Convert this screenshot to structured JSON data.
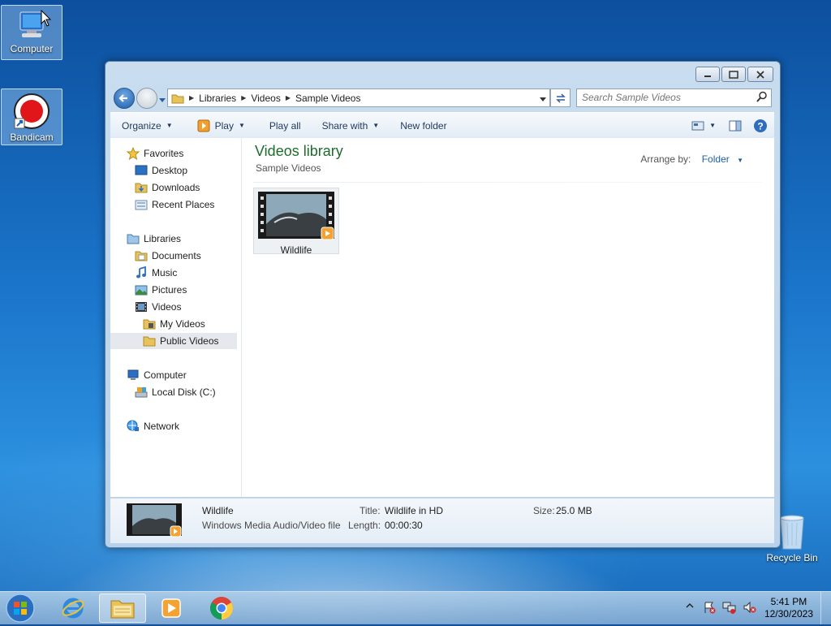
{
  "desktop": {
    "icons": [
      {
        "label": "Computer"
      },
      {
        "label": "Bandicam"
      },
      {
        "label": "Recycle Bin"
      }
    ]
  },
  "window": {
    "breadcrumb": [
      "Libraries",
      "Videos",
      "Sample Videos"
    ],
    "search_placeholder": "Search Sample Videos",
    "toolbar": {
      "organize": "Organize",
      "play": "Play",
      "play_all": "Play all",
      "share_with": "Share with",
      "new_folder": "New folder"
    },
    "nav": {
      "favorites": "Favorites",
      "desktop": "Desktop",
      "downloads": "Downloads",
      "recent_places": "Recent Places",
      "libraries": "Libraries",
      "documents": "Documents",
      "music": "Music",
      "pictures": "Pictures",
      "videos": "Videos",
      "my_videos": "My Videos",
      "public_videos": "Public Videos",
      "computer": "Computer",
      "local_disk": "Local Disk (C:)",
      "network": "Network"
    },
    "library": {
      "title": "Videos library",
      "subtitle": "Sample Videos",
      "arrange_label": "Arrange by:",
      "arrange_value": "Folder"
    },
    "files": [
      {
        "name": "Wildlife"
      }
    ],
    "details": {
      "name": "Wildlife",
      "type": "Windows Media Audio/Video file",
      "title_label": "Title:",
      "title_value": "Wildlife in HD",
      "length_label": "Length:",
      "length_value": "00:00:30",
      "size_label": "Size:",
      "size_value": "25.0 MB"
    }
  },
  "taskbar": {
    "time": "5:41 PM",
    "date": "12/30/2023"
  },
  "colors": {
    "library_title": "#1e6b2e",
    "link": "#1e5fa4",
    "selection": "#e5e9ee"
  }
}
